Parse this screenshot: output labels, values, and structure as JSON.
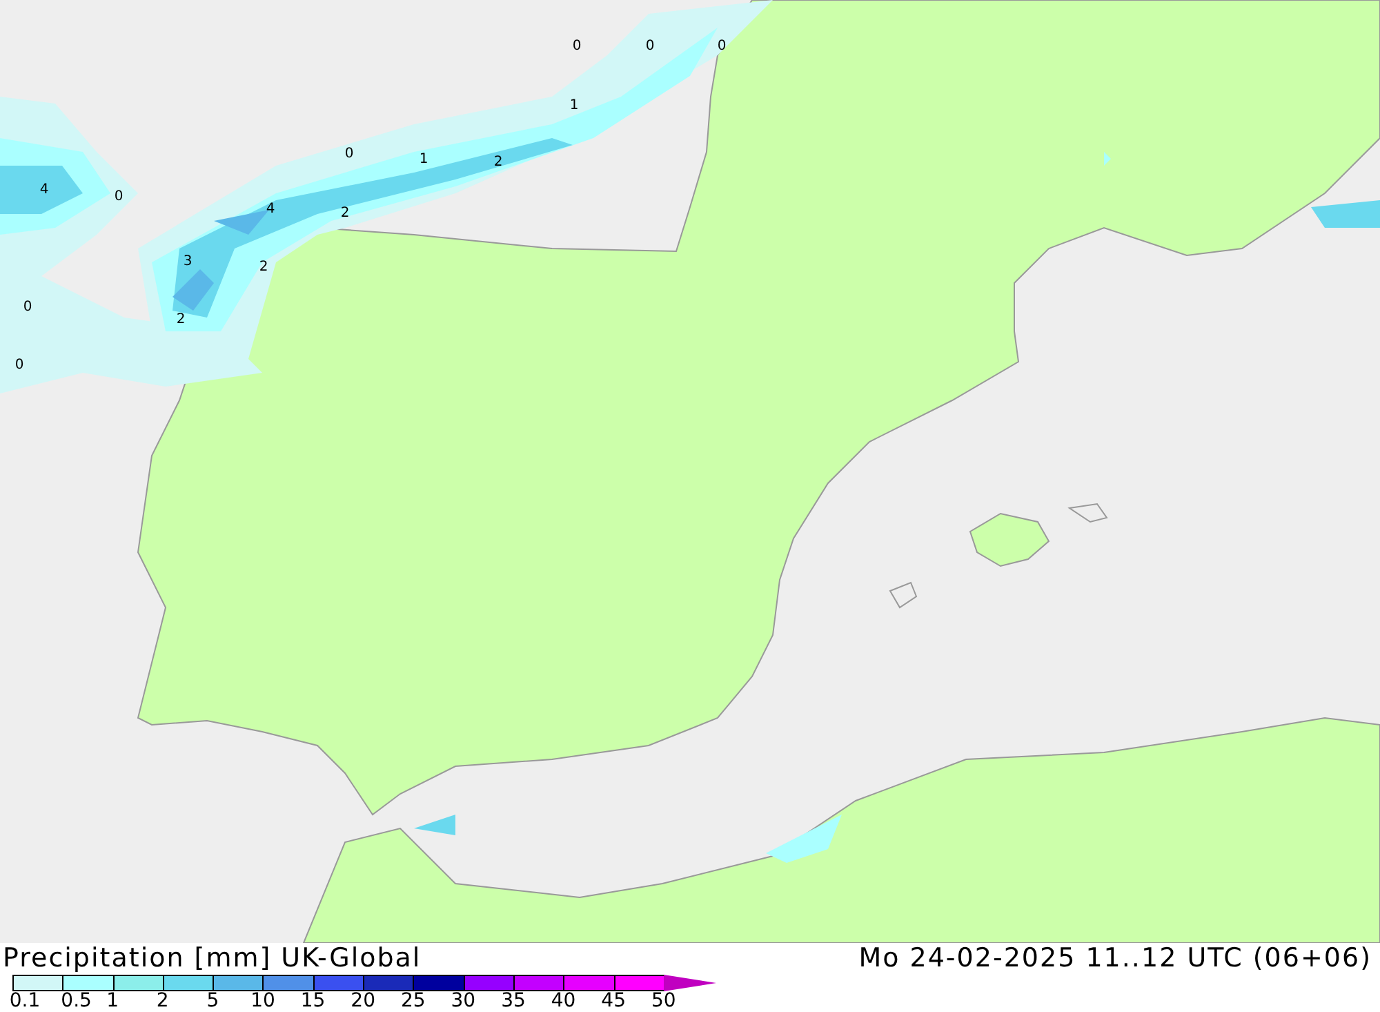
{
  "map": {
    "value_labels": [
      "0",
      "0",
      "0",
      "1",
      "0",
      "1",
      "2",
      "4",
      "0",
      "4",
      "2",
      "3",
      "2",
      "0",
      "2",
      "0"
    ]
  },
  "title": "Precipitation [mm] UK-Global",
  "valid_time": "Mo 24-02-2025 11..12 UTC (06+06)",
  "legend": {
    "bins": [
      {
        "label": "0.1",
        "color": "#d2f7f7"
      },
      {
        "label": "0.5",
        "color": "#aaffff"
      },
      {
        "label": "1",
        "color": "#8ceeea"
      },
      {
        "label": "2",
        "color": "#6ad9ee"
      },
      {
        "label": "5",
        "color": "#5ab8e8"
      },
      {
        "label": "10",
        "color": "#5090e8"
      },
      {
        "label": "15",
        "color": "#3a50f0"
      },
      {
        "label": "20",
        "color": "#1a2ab8"
      },
      {
        "label": "25",
        "color": "#00009e"
      },
      {
        "label": "30",
        "color": "#9600ff"
      },
      {
        "label": "35",
        "color": "#c300ff"
      },
      {
        "label": "40",
        "color": "#e600ff"
      },
      {
        "label": "45",
        "color": "#ff00ff"
      },
      {
        "label": "50",
        "color": "#c000c0"
      }
    ]
  }
}
